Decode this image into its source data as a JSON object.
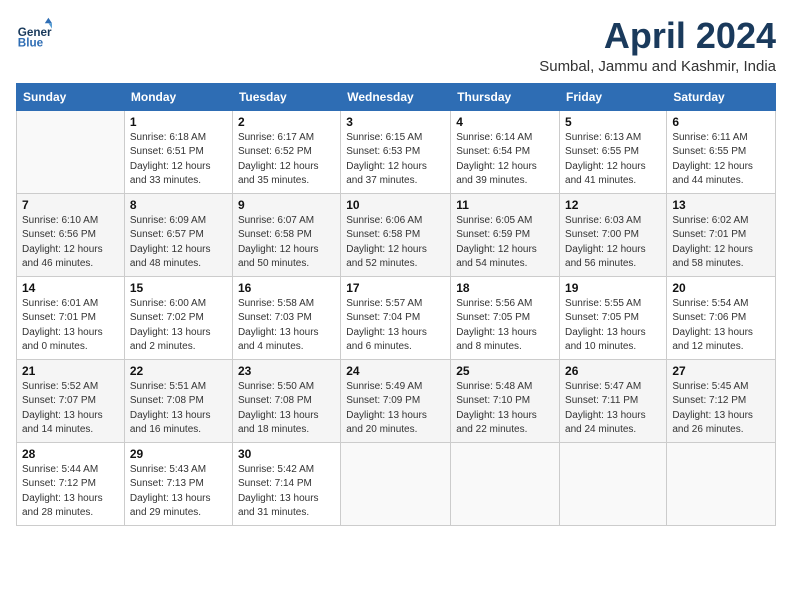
{
  "header": {
    "logo_general": "General",
    "logo_blue": "Blue",
    "month": "April 2024",
    "location": "Sumbal, Jammu and Kashmir, India"
  },
  "columns": [
    "Sunday",
    "Monday",
    "Tuesday",
    "Wednesday",
    "Thursday",
    "Friday",
    "Saturday"
  ],
  "weeks": [
    [
      {
        "day": "",
        "info": ""
      },
      {
        "day": "1",
        "info": "Sunrise: 6:18 AM\nSunset: 6:51 PM\nDaylight: 12 hours\nand 33 minutes."
      },
      {
        "day": "2",
        "info": "Sunrise: 6:17 AM\nSunset: 6:52 PM\nDaylight: 12 hours\nand 35 minutes."
      },
      {
        "day": "3",
        "info": "Sunrise: 6:15 AM\nSunset: 6:53 PM\nDaylight: 12 hours\nand 37 minutes."
      },
      {
        "day": "4",
        "info": "Sunrise: 6:14 AM\nSunset: 6:54 PM\nDaylight: 12 hours\nand 39 minutes."
      },
      {
        "day": "5",
        "info": "Sunrise: 6:13 AM\nSunset: 6:55 PM\nDaylight: 12 hours\nand 41 minutes."
      },
      {
        "day": "6",
        "info": "Sunrise: 6:11 AM\nSunset: 6:55 PM\nDaylight: 12 hours\nand 44 minutes."
      }
    ],
    [
      {
        "day": "7",
        "info": "Sunrise: 6:10 AM\nSunset: 6:56 PM\nDaylight: 12 hours\nand 46 minutes."
      },
      {
        "day": "8",
        "info": "Sunrise: 6:09 AM\nSunset: 6:57 PM\nDaylight: 12 hours\nand 48 minutes."
      },
      {
        "day": "9",
        "info": "Sunrise: 6:07 AM\nSunset: 6:58 PM\nDaylight: 12 hours\nand 50 minutes."
      },
      {
        "day": "10",
        "info": "Sunrise: 6:06 AM\nSunset: 6:58 PM\nDaylight: 12 hours\nand 52 minutes."
      },
      {
        "day": "11",
        "info": "Sunrise: 6:05 AM\nSunset: 6:59 PM\nDaylight: 12 hours\nand 54 minutes."
      },
      {
        "day": "12",
        "info": "Sunrise: 6:03 AM\nSunset: 7:00 PM\nDaylight: 12 hours\nand 56 minutes."
      },
      {
        "day": "13",
        "info": "Sunrise: 6:02 AM\nSunset: 7:01 PM\nDaylight: 12 hours\nand 58 minutes."
      }
    ],
    [
      {
        "day": "14",
        "info": "Sunrise: 6:01 AM\nSunset: 7:01 PM\nDaylight: 13 hours\nand 0 minutes."
      },
      {
        "day": "15",
        "info": "Sunrise: 6:00 AM\nSunset: 7:02 PM\nDaylight: 13 hours\nand 2 minutes."
      },
      {
        "day": "16",
        "info": "Sunrise: 5:58 AM\nSunset: 7:03 PM\nDaylight: 13 hours\nand 4 minutes."
      },
      {
        "day": "17",
        "info": "Sunrise: 5:57 AM\nSunset: 7:04 PM\nDaylight: 13 hours\nand 6 minutes."
      },
      {
        "day": "18",
        "info": "Sunrise: 5:56 AM\nSunset: 7:05 PM\nDaylight: 13 hours\nand 8 minutes."
      },
      {
        "day": "19",
        "info": "Sunrise: 5:55 AM\nSunset: 7:05 PM\nDaylight: 13 hours\nand 10 minutes."
      },
      {
        "day": "20",
        "info": "Sunrise: 5:54 AM\nSunset: 7:06 PM\nDaylight: 13 hours\nand 12 minutes."
      }
    ],
    [
      {
        "day": "21",
        "info": "Sunrise: 5:52 AM\nSunset: 7:07 PM\nDaylight: 13 hours\nand 14 minutes."
      },
      {
        "day": "22",
        "info": "Sunrise: 5:51 AM\nSunset: 7:08 PM\nDaylight: 13 hours\nand 16 minutes."
      },
      {
        "day": "23",
        "info": "Sunrise: 5:50 AM\nSunset: 7:08 PM\nDaylight: 13 hours\nand 18 minutes."
      },
      {
        "day": "24",
        "info": "Sunrise: 5:49 AM\nSunset: 7:09 PM\nDaylight: 13 hours\nand 20 minutes."
      },
      {
        "day": "25",
        "info": "Sunrise: 5:48 AM\nSunset: 7:10 PM\nDaylight: 13 hours\nand 22 minutes."
      },
      {
        "day": "26",
        "info": "Sunrise: 5:47 AM\nSunset: 7:11 PM\nDaylight: 13 hours\nand 24 minutes."
      },
      {
        "day": "27",
        "info": "Sunrise: 5:45 AM\nSunset: 7:12 PM\nDaylight: 13 hours\nand 26 minutes."
      }
    ],
    [
      {
        "day": "28",
        "info": "Sunrise: 5:44 AM\nSunset: 7:12 PM\nDaylight: 13 hours\nand 28 minutes."
      },
      {
        "day": "29",
        "info": "Sunrise: 5:43 AM\nSunset: 7:13 PM\nDaylight: 13 hours\nand 29 minutes."
      },
      {
        "day": "30",
        "info": "Sunrise: 5:42 AM\nSunset: 7:14 PM\nDaylight: 13 hours\nand 31 minutes."
      },
      {
        "day": "",
        "info": ""
      },
      {
        "day": "",
        "info": ""
      },
      {
        "day": "",
        "info": ""
      },
      {
        "day": "",
        "info": ""
      }
    ]
  ]
}
